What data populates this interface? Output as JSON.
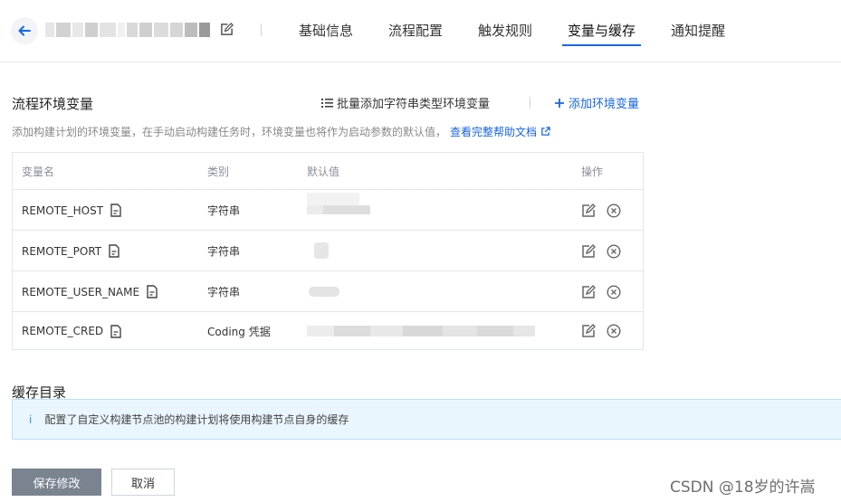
{
  "header": {
    "tabs": [
      {
        "label": "基础信息"
      },
      {
        "label": "流程配置"
      },
      {
        "label": "触发规则"
      },
      {
        "label": "变量与缓存",
        "active": true
      },
      {
        "label": "通知提醒"
      }
    ]
  },
  "env_section": {
    "title": "流程环境变量",
    "batch_add_label": "批量添加字符串类型环境变量",
    "add_label": "添加环境变量",
    "description": "添加构建计划的环境变量，在手动启动构建任务时，环境变量也将作为启动参数的默认值，",
    "help_link": "查看完整帮助文档"
  },
  "table": {
    "columns": [
      "变量名",
      "类别",
      "默认值",
      "操作"
    ],
    "rows": [
      {
        "name": "REMOTE_HOST",
        "type": "字符串"
      },
      {
        "name": "REMOTE_PORT",
        "type": "字符串"
      },
      {
        "name": "REMOTE_USER_NAME",
        "type": "字符串"
      },
      {
        "name": "REMOTE_CRED",
        "type": "Coding 凭据"
      }
    ]
  },
  "cache_section": {
    "title": "缓存目录",
    "info_text": "配置了自定义构建节点池的构建计划将使用构建节点自身的缓存"
  },
  "footer": {
    "save_label": "保存修改",
    "cancel_label": "取消"
  },
  "watermark": "CSDN @18岁的许嵩",
  "colors": {
    "accent": "#1766e6",
    "info_bg": "#eaf6fd"
  }
}
